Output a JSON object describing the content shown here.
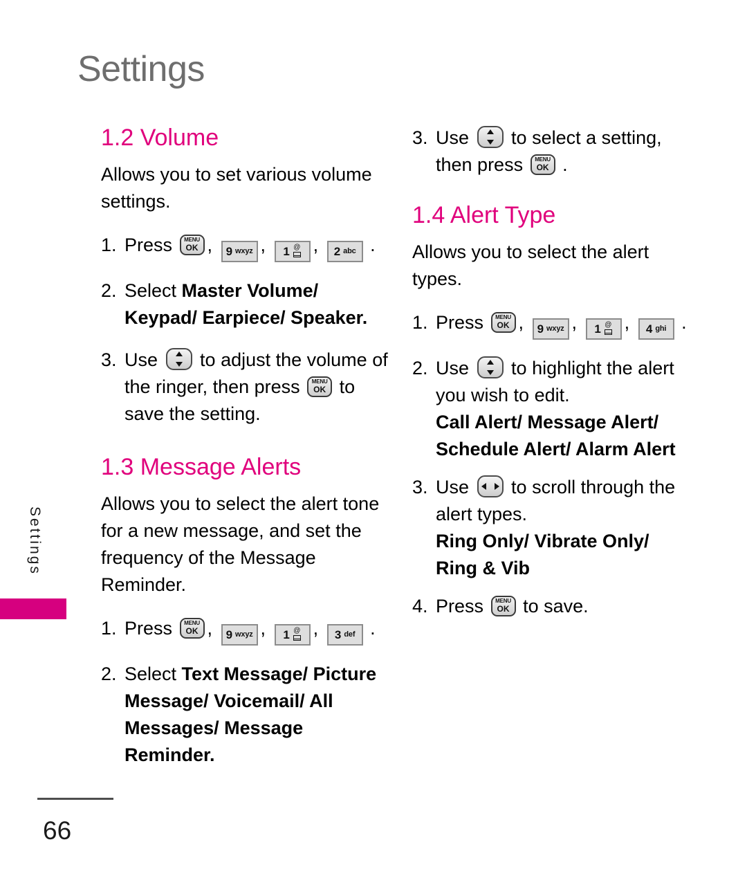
{
  "page": {
    "header_title": "Settings",
    "side_tab_label": "Settings",
    "page_number": "66",
    "accent_color": "#e0007c",
    "header_color": "#6e6e6e"
  },
  "keys": {
    "menuok": {
      "icon": "menu-ok-key-icon",
      "line1": "MENU",
      "line2": "OK"
    },
    "nine": {
      "icon": "keypad-9-key-icon",
      "digit": "9",
      "letters": "wxyz"
    },
    "one": {
      "icon": "keypad-1-key-icon",
      "digit": "1",
      "letters": "@/envelope"
    },
    "two": {
      "icon": "keypad-2-key-icon",
      "digit": "2",
      "letters": "abc"
    },
    "three": {
      "icon": "keypad-3-key-icon",
      "digit": "3",
      "letters": "def"
    },
    "four": {
      "icon": "keypad-4-key-icon",
      "digit": "4",
      "letters": "ghi"
    },
    "updown": {
      "icon": "nav-up-down-key-icon"
    },
    "leftright": {
      "icon": "nav-left-right-key-icon"
    }
  },
  "left_column": {
    "section_volume": {
      "title": "1.2 Volume",
      "intro": "Allows you to set various volume settings.",
      "step1": {
        "num": "1.",
        "lead": "Press",
        "tail": "."
      },
      "step2": {
        "num": "2.",
        "lead": "Select ",
        "options_line1": "Master Volume/",
        "options_line2": "Keypad/ Earpiece/ Speaker",
        "tail": "."
      },
      "step3": {
        "num": "3.",
        "lead": "Use ",
        "mid": " to adjust the volume of the ringer, then press ",
        "tail": " to save the setting."
      }
    },
    "section_message_alerts": {
      "title": "1.3 Message Alerts",
      "intro": "Allows you to select the alert tone for a new message, and set the frequency of the Message Reminder.",
      "step1": {
        "num": "1.",
        "lead": "Press",
        "tail": "."
      },
      "step2": {
        "num": "2.",
        "lead": "Select ",
        "options_line1": "Text Message/ Picture",
        "options_line2": "Message/ Voicemail/ All",
        "options_line3": "Messages/ Message",
        "options_line4": "Reminder",
        "tail": "."
      }
    }
  },
  "right_column": {
    "volume_step3": {
      "num": "3.",
      "lead": "Use ",
      "mid": " to select a setting, then press ",
      "tail": "."
    },
    "section_alert_type": {
      "title": "1.4 Alert Type",
      "intro": "Allows you to select the alert types.",
      "step1": {
        "num": "1.",
        "lead": "Press",
        "tail": "."
      },
      "step2": {
        "num": "2.",
        "lead": "Use ",
        "mid": " to highlight the alert you wish to edit.",
        "options_line1": "Call Alert/ Message Alert/",
        "options_line2": "Schedule Alert/ Alarm Alert"
      },
      "step3": {
        "num": "3.",
        "lead": "Use ",
        "mid": " to scroll through the alert types.",
        "options_line1": "Ring Only/ Vibrate Only/",
        "options_line2": "Ring & Vib"
      },
      "step4": {
        "num": "4.",
        "lead": "Press",
        "tail": " to save."
      }
    }
  }
}
